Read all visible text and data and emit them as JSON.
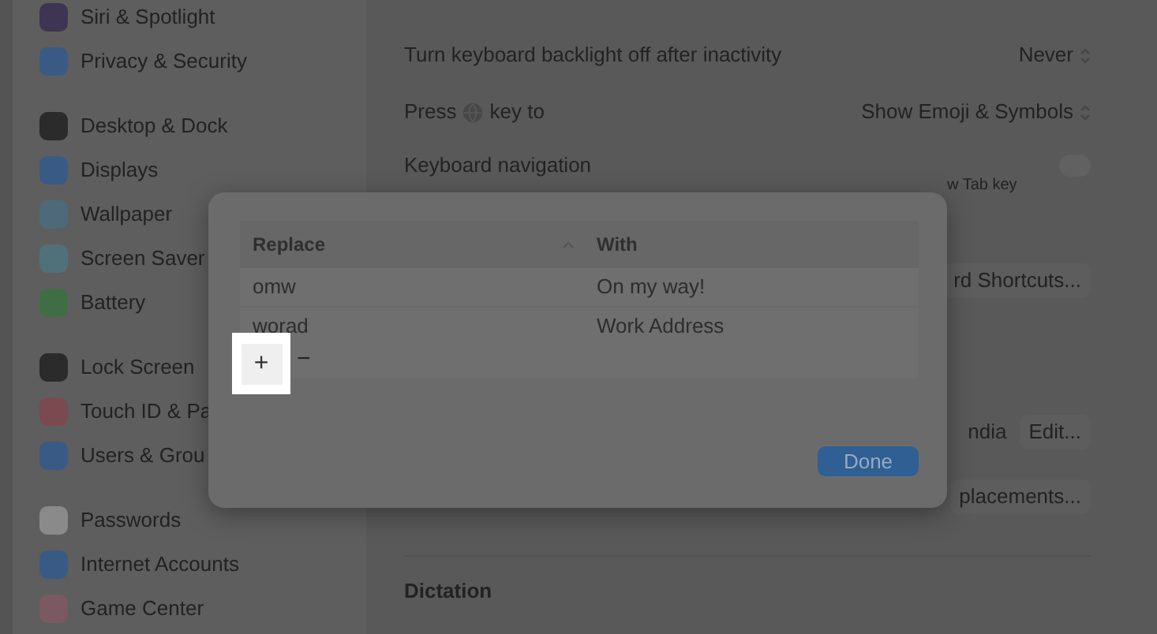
{
  "sidebar": {
    "groups": [
      {
        "items": [
          {
            "label": "Siri & Spotlight",
            "color": "#3d3552"
          },
          {
            "label": "Privacy & Security",
            "color": "#3a5a86"
          }
        ]
      },
      {
        "items": [
          {
            "label": "Desktop & Dock",
            "color": "#2b2b2b"
          },
          {
            "label": "Displays",
            "color": "#3a5a86"
          },
          {
            "label": "Wallpaper",
            "color": "#4e6a7a"
          },
          {
            "label": "Screen Saver",
            "color": "#50707a"
          },
          {
            "label": "Battery",
            "color": "#3f6e44"
          }
        ]
      },
      {
        "items": [
          {
            "label": "Lock Screen",
            "color": "#2b2b2b"
          },
          {
            "label": "Touch ID & Pa",
            "color": "#7a4a50"
          },
          {
            "label": "Users & Grou",
            "color": "#3a5a86"
          }
        ]
      },
      {
        "items": [
          {
            "label": "Passwords",
            "color": "#8a8a8a"
          },
          {
            "label": "Internet Accounts",
            "color": "#3a5a86"
          },
          {
            "label": "Game Center",
            "color": "#7a5a60"
          }
        ]
      }
    ]
  },
  "settings": {
    "backlight": {
      "label": "Turn keyboard backlight off after inactivity",
      "value": "Never"
    },
    "globe_key": {
      "label_before": "Press",
      "label_after": "key to",
      "value": "Show Emoji & Symbols"
    },
    "keyboard_navigation": {
      "label": "Keyboard navigation",
      "on": false,
      "hint": "w Tab key"
    },
    "shortcuts_button": "rd Shortcuts...",
    "input_source": {
      "value": "ndia",
      "button": "Edit..."
    },
    "replacements_button": "placements...",
    "dictation_heading": "Dictation"
  },
  "dialog": {
    "columns": [
      {
        "label": "Replace",
        "sorted": true
      },
      {
        "label": "With",
        "sorted": false
      }
    ],
    "rows": [
      [
        "omw",
        "On my way!"
      ],
      [
        "worad",
        "Work Address"
      ]
    ],
    "add_button": "+",
    "remove_button": "−",
    "done_button": "Done"
  }
}
